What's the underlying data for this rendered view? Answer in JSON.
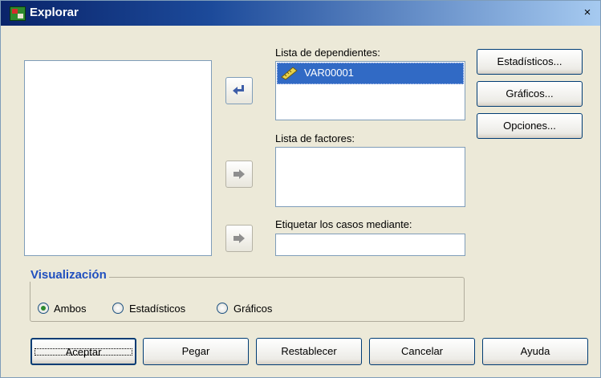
{
  "window": {
    "title": "Explorar",
    "close_label": "×"
  },
  "lists": {
    "dependientes_label": "Lista de dependientes:",
    "dependientes_items": [
      "VAR00001"
    ],
    "factores_label": "Lista de factores:",
    "etiquetar_label": "Etiquetar los casos mediante:",
    "etiquetar_value": ""
  },
  "side_buttons": {
    "estadisticos": "Estadísticos...",
    "graficos": "Gráficos...",
    "opciones": "Opciones..."
  },
  "visualizacion": {
    "title": "Visualización",
    "options": [
      "Ambos",
      "Estadísticos",
      "Gráficos"
    ],
    "selected": "Ambos"
  },
  "bottom_buttons": {
    "aceptar": "Aceptar",
    "pegar": "Pegar",
    "restablecer": "Restablecer",
    "cancelar": "Cancelar",
    "ayuda": "Ayuda"
  },
  "colors": {
    "title_bar": "#0a246a",
    "selection": "#316ac5",
    "group_title": "#1f4fbf",
    "dialog_bg": "#ece9d8"
  }
}
